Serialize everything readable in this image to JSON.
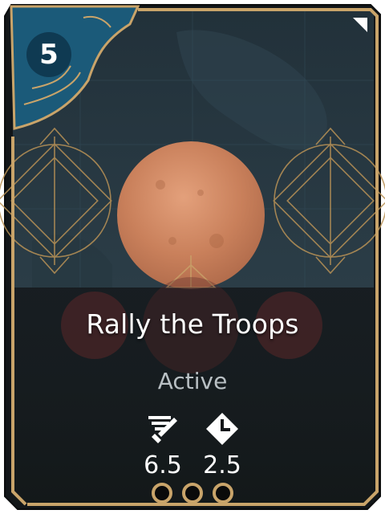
{
  "card": {
    "cost": "5",
    "title": "Rally the Troops",
    "type": "Active",
    "stats": {
      "damage_value": "6.5",
      "cooldown_value": "2.5"
    },
    "pips_count": 3
  },
  "icons": {
    "damage": "sword-speed-icon",
    "cooldown": "clock-icon",
    "corner": "corner-triangle-icon"
  },
  "colors": {
    "frame_gold": "#c9a46a",
    "frame_teal": "#1f5a78",
    "background_dark": "#1b2328",
    "orb": "#d38a63"
  }
}
